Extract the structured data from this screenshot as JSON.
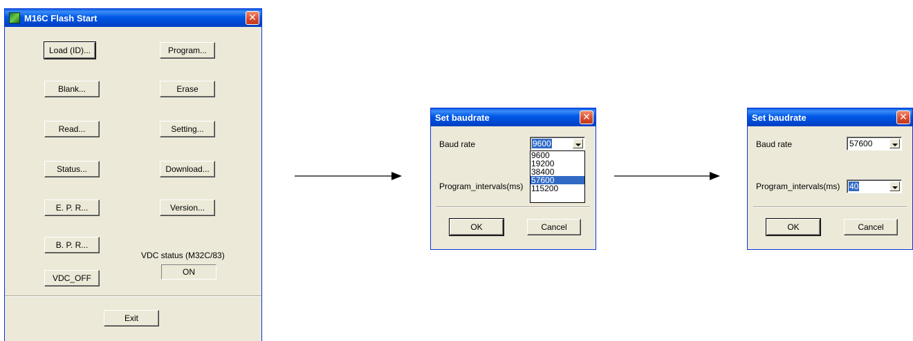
{
  "main_window": {
    "title": "M16C Flash Start",
    "buttons": {
      "load": "Load (ID)...",
      "program": "Program...",
      "blank": "Blank...",
      "erase": "Erase",
      "read": "Read...",
      "setting": "Setting...",
      "status": "Status...",
      "download": "Download...",
      "epr": "E. P. R...",
      "version": "Version...",
      "bpr": "B. P. R...",
      "vdc_off": "VDC_OFF",
      "exit": "Exit"
    },
    "vdc_status_label": "VDC status (M32C/83)",
    "vdc_status_value": "ON"
  },
  "dialog1": {
    "title": "Set baudrate",
    "baud_label": "Baud rate",
    "baud_value": "9600",
    "options": [
      "9600",
      "19200",
      "38400",
      "57600",
      "115200"
    ],
    "highlighted_option": "57600",
    "interval_label": "Program_intervals(ms)",
    "ok": "OK",
    "cancel": "Cancel"
  },
  "dialog2": {
    "title": "Set baudrate",
    "baud_label": "Baud rate",
    "baud_value": "57600",
    "interval_label": "Program_intervals(ms)",
    "interval_value": "40",
    "ok": "OK",
    "cancel": "Cancel"
  },
  "icons": {
    "close": "close-icon",
    "app": "app-icon",
    "dropdown": "chevron-down-icon",
    "flow": "arrow-right-icon"
  }
}
